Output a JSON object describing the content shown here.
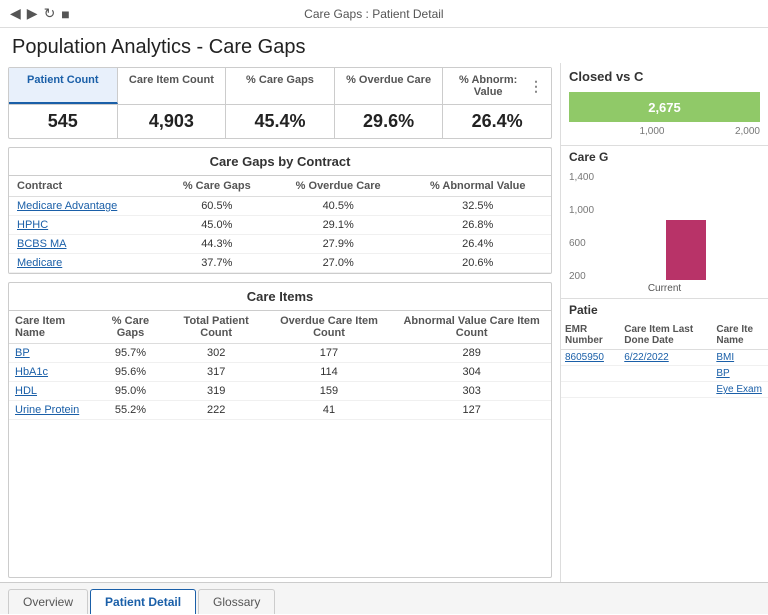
{
  "titlebar": {
    "title": "Care Gaps : Patient Detail",
    "nav_back": "◀",
    "nav_forward": "▶",
    "nav_refresh": "↻",
    "nav_grid": "▦"
  },
  "page_title": "Population Analytics - Care Gaps",
  "summary": {
    "columns": [
      {
        "header": "Patient Count",
        "value": "545",
        "active": true
      },
      {
        "header": "Care Item Count",
        "value": "4,903",
        "active": false
      },
      {
        "header": "% Care Gaps",
        "value": "45.4%",
        "active": false
      },
      {
        "header": "% Overdue Care",
        "value": "29.6%",
        "active": false
      },
      {
        "header": "% Abnorm: Value",
        "value": "26.4%",
        "active": false
      }
    ]
  },
  "contract_section": {
    "title": "Care Gaps by Contract",
    "headers": [
      "Contract",
      "% Care Gaps",
      "% Overdue Care",
      "% Abnormal Value"
    ],
    "rows": [
      {
        "contract": "Medicare Advantage",
        "care_gaps": "60.5%",
        "overdue_care": "40.5%",
        "abnormal": "32.5%"
      },
      {
        "contract": "HPHC",
        "care_gaps": "45.0%",
        "overdue_care": "29.1%",
        "abnormal": "26.8%"
      },
      {
        "contract": "BCBS MA",
        "care_gaps": "44.3%",
        "overdue_care": "27.9%",
        "abnormal": "26.4%"
      },
      {
        "contract": "Medicare",
        "care_gaps": "37.7%",
        "overdue_care": "27.0%",
        "abnormal": "20.6%"
      }
    ]
  },
  "items_section": {
    "title": "Care Items",
    "headers": [
      "Care Item Name",
      "% Care Gaps",
      "Total Patient Count",
      "Overdue Care Item Count",
      "Abnormal Value Care Item Count"
    ],
    "rows": [
      {
        "name": "BP",
        "pct": "95.7%",
        "total": "302",
        "overdue": "177",
        "abnormal": "289"
      },
      {
        "name": "HbA1c",
        "pct": "95.6%",
        "total": "317",
        "overdue": "114",
        "abnormal": "304"
      },
      {
        "name": "HDL",
        "pct": "95.0%",
        "total": "319",
        "overdue": "159",
        "abnormal": "303"
      },
      {
        "name": "Urine Protein",
        "pct": "55.2%",
        "total": "222",
        "overdue": "41",
        "abnormal": "127"
      }
    ]
  },
  "right_panel": {
    "closed_title": "Closed vs C",
    "bar_value": "2,675",
    "axis_labels": [
      "1,000",
      "2,000"
    ],
    "care_g_title": "Care G",
    "y_axis_labels": [
      "1,400",
      "1,000",
      "600",
      "200"
    ],
    "x_label": "Current",
    "patient_title": "Patie",
    "patient_headers": [
      "EMR Number",
      "Care Item Last Done Date",
      "Care Ite Name"
    ],
    "patient_rows": [
      {
        "emr": "8605950",
        "date": "6/22/2022",
        "item": "BMI"
      },
      {
        "emr": "",
        "date": "",
        "item": "BP"
      },
      {
        "emr": "",
        "date": "",
        "item": "Eye Exam"
      }
    ]
  },
  "tabs": [
    {
      "label": "Overview",
      "active": false
    },
    {
      "label": "Patient Detail",
      "active": true
    },
    {
      "label": "Glossary",
      "active": false
    }
  ]
}
